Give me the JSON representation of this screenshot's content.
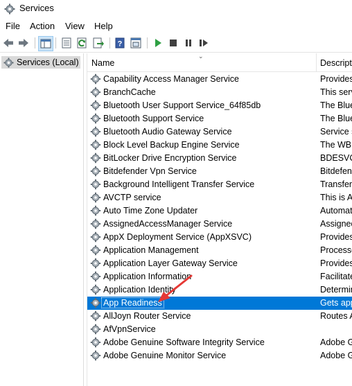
{
  "window": {
    "title": "Services"
  },
  "menu": [
    "File",
    "Action",
    "View",
    "Help"
  ],
  "tree": {
    "root_label": "Services (Local)"
  },
  "columns": {
    "name": "Name",
    "description": "Descripti"
  },
  "services": [
    {
      "name": "Capability Access Manager Service",
      "description": "Provides"
    },
    {
      "name": "BranchCache",
      "description": "This servi"
    },
    {
      "name": "Bluetooth User Support Service_64f85db",
      "description": "The Blue"
    },
    {
      "name": "Bluetooth Support Service",
      "description": "The Blue"
    },
    {
      "name": "Bluetooth Audio Gateway Service",
      "description": "Service s"
    },
    {
      "name": "Block Level Backup Engine Service",
      "description": "The WBE"
    },
    {
      "name": "BitLocker Drive Encryption Service",
      "description": "BDESVC"
    },
    {
      "name": "Bitdefender Vpn Service",
      "description": "Bitdefend"
    },
    {
      "name": "Background Intelligent Transfer Service",
      "description": "Transfers"
    },
    {
      "name": "AVCTP service",
      "description": "This is A"
    },
    {
      "name": "Auto Time Zone Updater",
      "description": "Automati"
    },
    {
      "name": "AssignedAccessManager Service",
      "description": "Assigned"
    },
    {
      "name": "AppX Deployment Service (AppXSVC)",
      "description": "Provides"
    },
    {
      "name": "Application Management",
      "description": "Processe"
    },
    {
      "name": "Application Layer Gateway Service",
      "description": "Provides"
    },
    {
      "name": "Application Information",
      "description": "Facilitate"
    },
    {
      "name": "Application Identity",
      "description": "Determin"
    },
    {
      "name": "App Readiness",
      "description": "Gets app",
      "selected": true
    },
    {
      "name": "AllJoyn Router Service",
      "description": "Routes A"
    },
    {
      "name": "AfVpnService",
      "description": ""
    },
    {
      "name": "Adobe Genuine Software Integrity Service",
      "description": "Adobe G"
    },
    {
      "name": "Adobe Genuine Monitor Service",
      "description": "Adobe G"
    }
  ],
  "colors": {
    "selection": "#0078d7",
    "annotation_arrow": "#e53935"
  },
  "icons": [
    "services-gear-icon",
    "back-arrow-icon",
    "forward-arrow-icon",
    "show-hide-console-tree-icon",
    "properties-icon",
    "refresh-icon",
    "export-list-icon",
    "help-icon",
    "console-icon",
    "start-service-icon",
    "stop-service-icon",
    "pause-service-icon",
    "restart-service-icon"
  ]
}
